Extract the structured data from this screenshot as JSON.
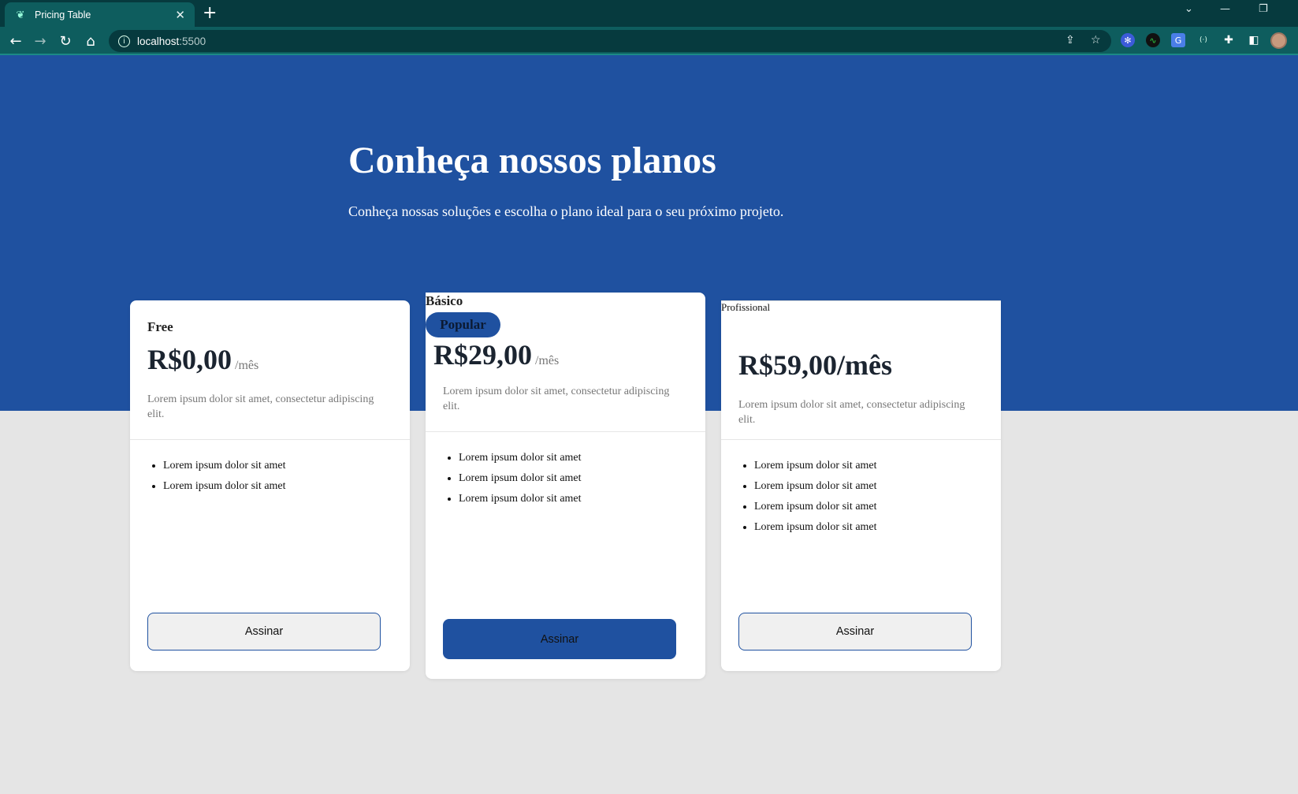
{
  "browser": {
    "tab_title": "Pricing Table",
    "tab_close": "✕",
    "new_tab": "+",
    "url_host": "localhost",
    "url_port": ":5500"
  },
  "hero": {
    "title": "Conheça nossos planos",
    "subtitle": "Conheça nossas soluções e escolha o plano ideal para o seu próximo projeto."
  },
  "plans": [
    {
      "name": "Free",
      "price": "R$0,00",
      "period": "/mês",
      "description": "Lorem ipsum dolor sit amet, consectetur adipiscing elit.",
      "features": [
        "Lorem ipsum dolor sit amet",
        "Lorem ipsum dolor sit amet"
      ],
      "button": "Assinar"
    },
    {
      "name": "Básico",
      "badge": "Popular",
      "price": "R$29,00",
      "period": "/mês",
      "description": "Lorem ipsum dolor sit amet, consectetur adipiscing elit.",
      "features": [
        "Lorem ipsum dolor sit amet",
        "Lorem ipsum dolor sit amet",
        "Lorem ipsum dolor sit amet"
      ],
      "button": "Assinar"
    },
    {
      "name": "Profissional",
      "price": "R$59,00/mês",
      "description": "Lorem ipsum dolor sit amet, consectetur adipiscing elit.",
      "features": [
        "Lorem ipsum dolor sit amet",
        "Lorem ipsum dolor sit amet",
        "Lorem ipsum dolor sit amet",
        "Lorem ipsum dolor sit amet"
      ],
      "button": "Assinar"
    }
  ],
  "colors": {
    "primary": "#1f51a0",
    "page_background": "#e5e5e5",
    "chrome_dark": "#063a3e",
    "chrome_tab": "#0e5d5e"
  }
}
